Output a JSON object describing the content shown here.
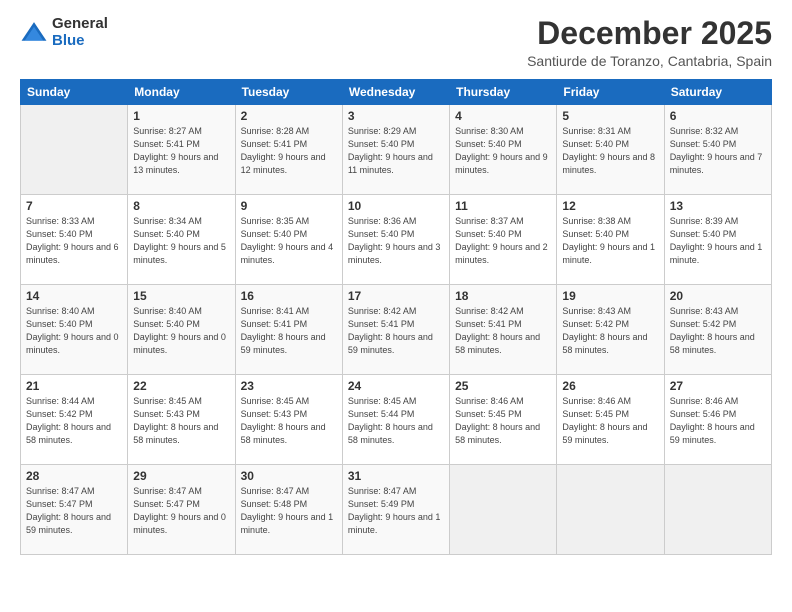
{
  "logo": {
    "general": "General",
    "blue": "Blue"
  },
  "title": "December 2025",
  "location": "Santiurde de Toranzo, Cantabria, Spain",
  "days_header": [
    "Sunday",
    "Monday",
    "Tuesday",
    "Wednesday",
    "Thursday",
    "Friday",
    "Saturday"
  ],
  "weeks": [
    [
      {
        "day": "",
        "sunrise": "",
        "sunset": "",
        "daylight": "",
        "empty": true
      },
      {
        "day": "1",
        "sunrise": "Sunrise: 8:27 AM",
        "sunset": "Sunset: 5:41 PM",
        "daylight": "Daylight: 9 hours and 13 minutes."
      },
      {
        "day": "2",
        "sunrise": "Sunrise: 8:28 AM",
        "sunset": "Sunset: 5:41 PM",
        "daylight": "Daylight: 9 hours and 12 minutes."
      },
      {
        "day": "3",
        "sunrise": "Sunrise: 8:29 AM",
        "sunset": "Sunset: 5:40 PM",
        "daylight": "Daylight: 9 hours and 11 minutes."
      },
      {
        "day": "4",
        "sunrise": "Sunrise: 8:30 AM",
        "sunset": "Sunset: 5:40 PM",
        "daylight": "Daylight: 9 hours and 9 minutes."
      },
      {
        "day": "5",
        "sunrise": "Sunrise: 8:31 AM",
        "sunset": "Sunset: 5:40 PM",
        "daylight": "Daylight: 9 hours and 8 minutes."
      },
      {
        "day": "6",
        "sunrise": "Sunrise: 8:32 AM",
        "sunset": "Sunset: 5:40 PM",
        "daylight": "Daylight: 9 hours and 7 minutes."
      }
    ],
    [
      {
        "day": "7",
        "sunrise": "Sunrise: 8:33 AM",
        "sunset": "Sunset: 5:40 PM",
        "daylight": "Daylight: 9 hours and 6 minutes."
      },
      {
        "day": "8",
        "sunrise": "Sunrise: 8:34 AM",
        "sunset": "Sunset: 5:40 PM",
        "daylight": "Daylight: 9 hours and 5 minutes."
      },
      {
        "day": "9",
        "sunrise": "Sunrise: 8:35 AM",
        "sunset": "Sunset: 5:40 PM",
        "daylight": "Daylight: 9 hours and 4 minutes."
      },
      {
        "day": "10",
        "sunrise": "Sunrise: 8:36 AM",
        "sunset": "Sunset: 5:40 PM",
        "daylight": "Daylight: 9 hours and 3 minutes."
      },
      {
        "day": "11",
        "sunrise": "Sunrise: 8:37 AM",
        "sunset": "Sunset: 5:40 PM",
        "daylight": "Daylight: 9 hours and 2 minutes."
      },
      {
        "day": "12",
        "sunrise": "Sunrise: 8:38 AM",
        "sunset": "Sunset: 5:40 PM",
        "daylight": "Daylight: 9 hours and 1 minute."
      },
      {
        "day": "13",
        "sunrise": "Sunrise: 8:39 AM",
        "sunset": "Sunset: 5:40 PM",
        "daylight": "Daylight: 9 hours and 1 minute."
      }
    ],
    [
      {
        "day": "14",
        "sunrise": "Sunrise: 8:40 AM",
        "sunset": "Sunset: 5:40 PM",
        "daylight": "Daylight: 9 hours and 0 minutes."
      },
      {
        "day": "15",
        "sunrise": "Sunrise: 8:40 AM",
        "sunset": "Sunset: 5:40 PM",
        "daylight": "Daylight: 9 hours and 0 minutes."
      },
      {
        "day": "16",
        "sunrise": "Sunrise: 8:41 AM",
        "sunset": "Sunset: 5:41 PM",
        "daylight": "Daylight: 8 hours and 59 minutes."
      },
      {
        "day": "17",
        "sunrise": "Sunrise: 8:42 AM",
        "sunset": "Sunset: 5:41 PM",
        "daylight": "Daylight: 8 hours and 59 minutes."
      },
      {
        "day": "18",
        "sunrise": "Sunrise: 8:42 AM",
        "sunset": "Sunset: 5:41 PM",
        "daylight": "Daylight: 8 hours and 58 minutes."
      },
      {
        "day": "19",
        "sunrise": "Sunrise: 8:43 AM",
        "sunset": "Sunset: 5:42 PM",
        "daylight": "Daylight: 8 hours and 58 minutes."
      },
      {
        "day": "20",
        "sunrise": "Sunrise: 8:43 AM",
        "sunset": "Sunset: 5:42 PM",
        "daylight": "Daylight: 8 hours and 58 minutes."
      }
    ],
    [
      {
        "day": "21",
        "sunrise": "Sunrise: 8:44 AM",
        "sunset": "Sunset: 5:42 PM",
        "daylight": "Daylight: 8 hours and 58 minutes."
      },
      {
        "day": "22",
        "sunrise": "Sunrise: 8:45 AM",
        "sunset": "Sunset: 5:43 PM",
        "daylight": "Daylight: 8 hours and 58 minutes."
      },
      {
        "day": "23",
        "sunrise": "Sunrise: 8:45 AM",
        "sunset": "Sunset: 5:43 PM",
        "daylight": "Daylight: 8 hours and 58 minutes."
      },
      {
        "day": "24",
        "sunrise": "Sunrise: 8:45 AM",
        "sunset": "Sunset: 5:44 PM",
        "daylight": "Daylight: 8 hours and 58 minutes."
      },
      {
        "day": "25",
        "sunrise": "Sunrise: 8:46 AM",
        "sunset": "Sunset: 5:45 PM",
        "daylight": "Daylight: 8 hours and 58 minutes."
      },
      {
        "day": "26",
        "sunrise": "Sunrise: 8:46 AM",
        "sunset": "Sunset: 5:45 PM",
        "daylight": "Daylight: 8 hours and 59 minutes."
      },
      {
        "day": "27",
        "sunrise": "Sunrise: 8:46 AM",
        "sunset": "Sunset: 5:46 PM",
        "daylight": "Daylight: 8 hours and 59 minutes."
      }
    ],
    [
      {
        "day": "28",
        "sunrise": "Sunrise: 8:47 AM",
        "sunset": "Sunset: 5:47 PM",
        "daylight": "Daylight: 8 hours and 59 minutes."
      },
      {
        "day": "29",
        "sunrise": "Sunrise: 8:47 AM",
        "sunset": "Sunset: 5:47 PM",
        "daylight": "Daylight: 9 hours and 0 minutes."
      },
      {
        "day": "30",
        "sunrise": "Sunrise: 8:47 AM",
        "sunset": "Sunset: 5:48 PM",
        "daylight": "Daylight: 9 hours and 1 minute."
      },
      {
        "day": "31",
        "sunrise": "Sunrise: 8:47 AM",
        "sunset": "Sunset: 5:49 PM",
        "daylight": "Daylight: 9 hours and 1 minute."
      },
      {
        "day": "",
        "sunrise": "",
        "sunset": "",
        "daylight": "",
        "empty": true
      },
      {
        "day": "",
        "sunrise": "",
        "sunset": "",
        "daylight": "",
        "empty": true
      },
      {
        "day": "",
        "sunrise": "",
        "sunset": "",
        "daylight": "",
        "empty": true
      }
    ]
  ]
}
